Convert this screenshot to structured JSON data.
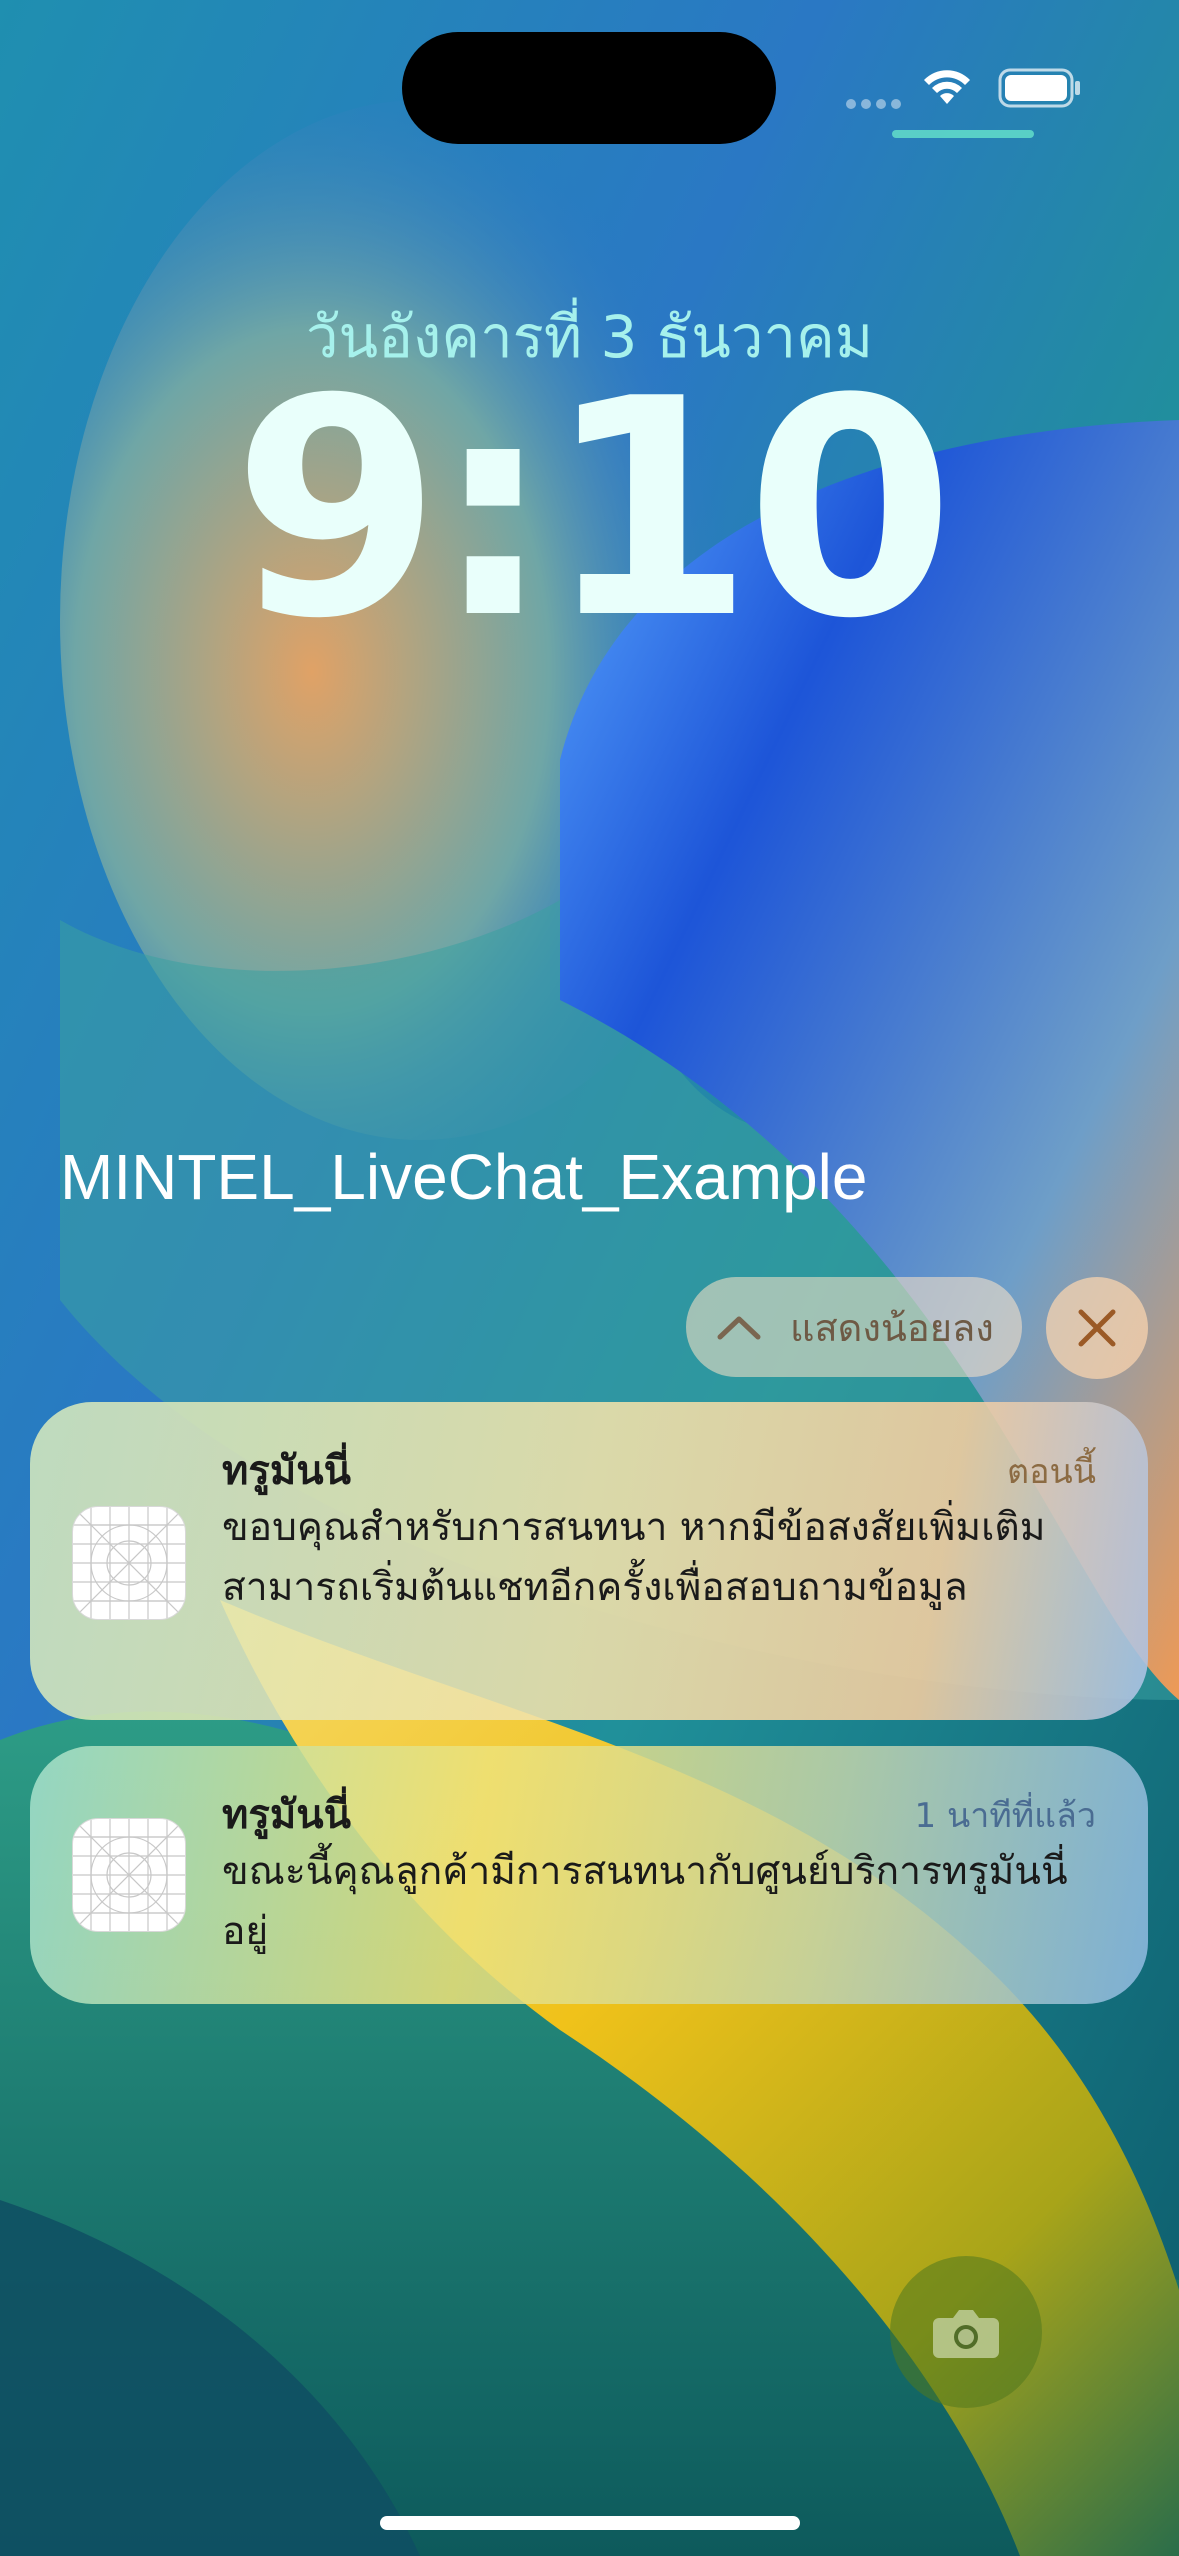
{
  "lock_screen": {
    "date": "วันอังคารที่ 3 ธันวาคม",
    "time": "9:10",
    "app_name": "MINTEL_LiveChat_Example"
  },
  "controls": {
    "show_less_label": "แสดงน้อยลง"
  },
  "notifications": [
    {
      "title": "ทรูมันนี่",
      "time": "ตอนนี้",
      "body": "ขอบคุณสำหรับการสนทนา หากมีข้อสงสัยเพิ่มเติมสามารถเริ่มต้นแชทอีกครั้งเพื่อสอบถามข้อมูล"
    },
    {
      "title": "ทรูมันนี่",
      "time": "1 นาทีที่แล้ว",
      "body": "ขณะนี้คุณลูกค้ามีการสนทนากับศูนย์บริการทรูมันนี่อยู่"
    }
  ],
  "icons": {
    "wifi": "wifi-icon",
    "battery": "battery-icon",
    "chevron": "chevron-up-icon",
    "close": "close-icon",
    "camera": "camera-icon",
    "app": "app-placeholder-icon"
  },
  "colors": {
    "date_text": "#a6f1ec",
    "clock_text": "#e9fffb",
    "accent_teal": "#5fd8c9"
  }
}
